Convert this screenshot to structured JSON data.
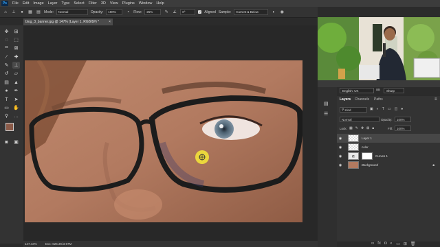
{
  "app": {
    "logo": "Ps"
  },
  "menu": [
    "File",
    "Edit",
    "Image",
    "Layer",
    "Type",
    "Select",
    "Filter",
    "3D",
    "View",
    "Plugins",
    "Window",
    "Help"
  ],
  "options": {
    "mode_label": "Mode:",
    "mode_value": "Normal",
    "opacity_label": "Opacity:",
    "opacity_value": "100%",
    "flow_label": "Flow:",
    "flow_value": "25%",
    "angle_value": "0°",
    "aligned_label": "Aligned",
    "sample_label": "Sample:",
    "sample_value": "Current & Below"
  },
  "document": {
    "tab_title": "blog_3_banner.jpg @ 147% (Layer 1, RGB/8#) *",
    "close_glyph": "×"
  },
  "status": {
    "zoom": "147.43%",
    "doc": "Doc: 625.3K/3.97M"
  },
  "panel_top": {
    "language": "English: UK",
    "aa": "aa",
    "sharp": "Sharp"
  },
  "layers_panel": {
    "tabs": [
      "Layers",
      "Channels",
      "Paths"
    ],
    "kind": "Kind",
    "blend": "Normal",
    "opacity_label": "Opacity:",
    "opacity_value": "100%",
    "lock_label": "Lock:",
    "fill_label": "Fill:",
    "fill_value": "100%",
    "layers": [
      "Layer 1",
      "color",
      "Curves 1",
      "Background"
    ]
  },
  "icons": [
    "move-tool",
    "marquee-tool",
    "lasso-tool",
    "crop-tool",
    "eyedropper-tool",
    "healing-tool",
    "brush-tool",
    "clone-stamp-tool",
    "eraser-tool",
    "gradient-tool",
    "dodge-tool",
    "pen-tool",
    "type-tool",
    "path-selection-tool",
    "shape-tool",
    "hand-tool",
    "zoom-tool"
  ],
  "colors": {
    "accent": "#31a8ff",
    "foreground": "#8a5a48",
    "background": "#000000"
  }
}
